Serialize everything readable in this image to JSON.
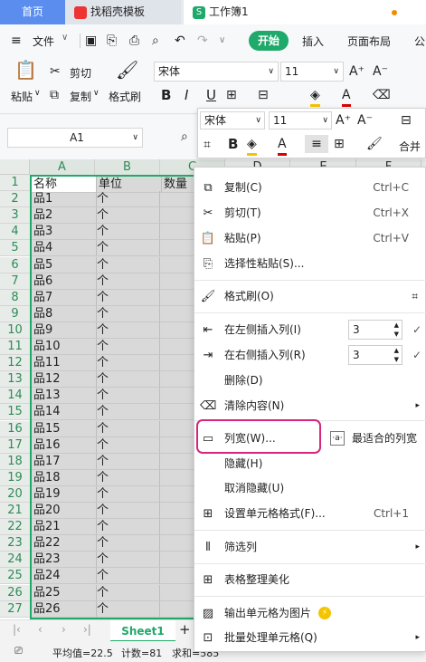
{
  "tabs": {
    "home": "首页",
    "template": "找稻壳模板",
    "workbook": "工作簿1"
  },
  "menu": {
    "file": "文件",
    "start": "开始",
    "insert": "插入",
    "layout": "页面布局",
    "formula": "公"
  },
  "ribbon": {
    "paste": "粘贴",
    "cut": "剪切",
    "copy": "复制",
    "format_painter": "格式刷",
    "font": "宋体",
    "size": "11",
    "bold": "B",
    "italic": "I",
    "underline": "U"
  },
  "namebox": "A1",
  "mini": {
    "font": "宋体",
    "size": "11",
    "merge": "合并"
  },
  "columns": [
    "A",
    "B",
    "C",
    "D",
    "E",
    "F"
  ],
  "rows": [
    "1",
    "2",
    "3",
    "4",
    "5",
    "6",
    "7",
    "8",
    "9",
    "10",
    "11",
    "12",
    "13",
    "14",
    "15",
    "16",
    "17",
    "18",
    "19",
    "20",
    "21",
    "22",
    "23",
    "24",
    "25",
    "26",
    "27"
  ],
  "header_row": [
    "名称",
    "单位",
    "数量"
  ],
  "unit": "个",
  "items": [
    "品1",
    "品2",
    "品3",
    "品4",
    "品5",
    "品6",
    "品7",
    "品8",
    "品9",
    "品10",
    "品11",
    "品12",
    "品13",
    "品14",
    "品15",
    "品16",
    "品17",
    "品18",
    "品19",
    "品20",
    "品21",
    "品22",
    "品23",
    "品24",
    "品25",
    "品26"
  ],
  "sheet": {
    "name": "Sheet1"
  },
  "status": {
    "avg": "平均值=22.5",
    "count": "计数=81",
    "sum": "求和=585"
  },
  "context": {
    "copy": "复制(C)",
    "copy_key": "Ctrl+C",
    "cut": "剪切(T)",
    "cut_key": "Ctrl+X",
    "paste": "粘贴(P)",
    "paste_key": "Ctrl+V",
    "paste_special": "选择性粘贴(S)...",
    "format_painter": "格式刷(O)",
    "insert_left": "在左侧插入列(I)",
    "insert_left_val": "3",
    "insert_right": "在右侧插入列(R)",
    "insert_right_val": "3",
    "delete": "删除(D)",
    "clear": "清除内容(N)",
    "col_width": "列宽(W)...",
    "best_fit": "最适合的列宽",
    "hide": "隐藏(H)",
    "unhide": "取消隐藏(U)",
    "format_cells": "设置单元格格式(F)...",
    "format_cells_key": "Ctrl+1",
    "filter": "筛选列",
    "beautify": "表格整理美化",
    "export_img": "输出单元格为图片",
    "batch": "批量处理单元格(Q)"
  },
  "colors": {
    "accent": "#1fa96b",
    "highlight": "#d6257c"
  }
}
